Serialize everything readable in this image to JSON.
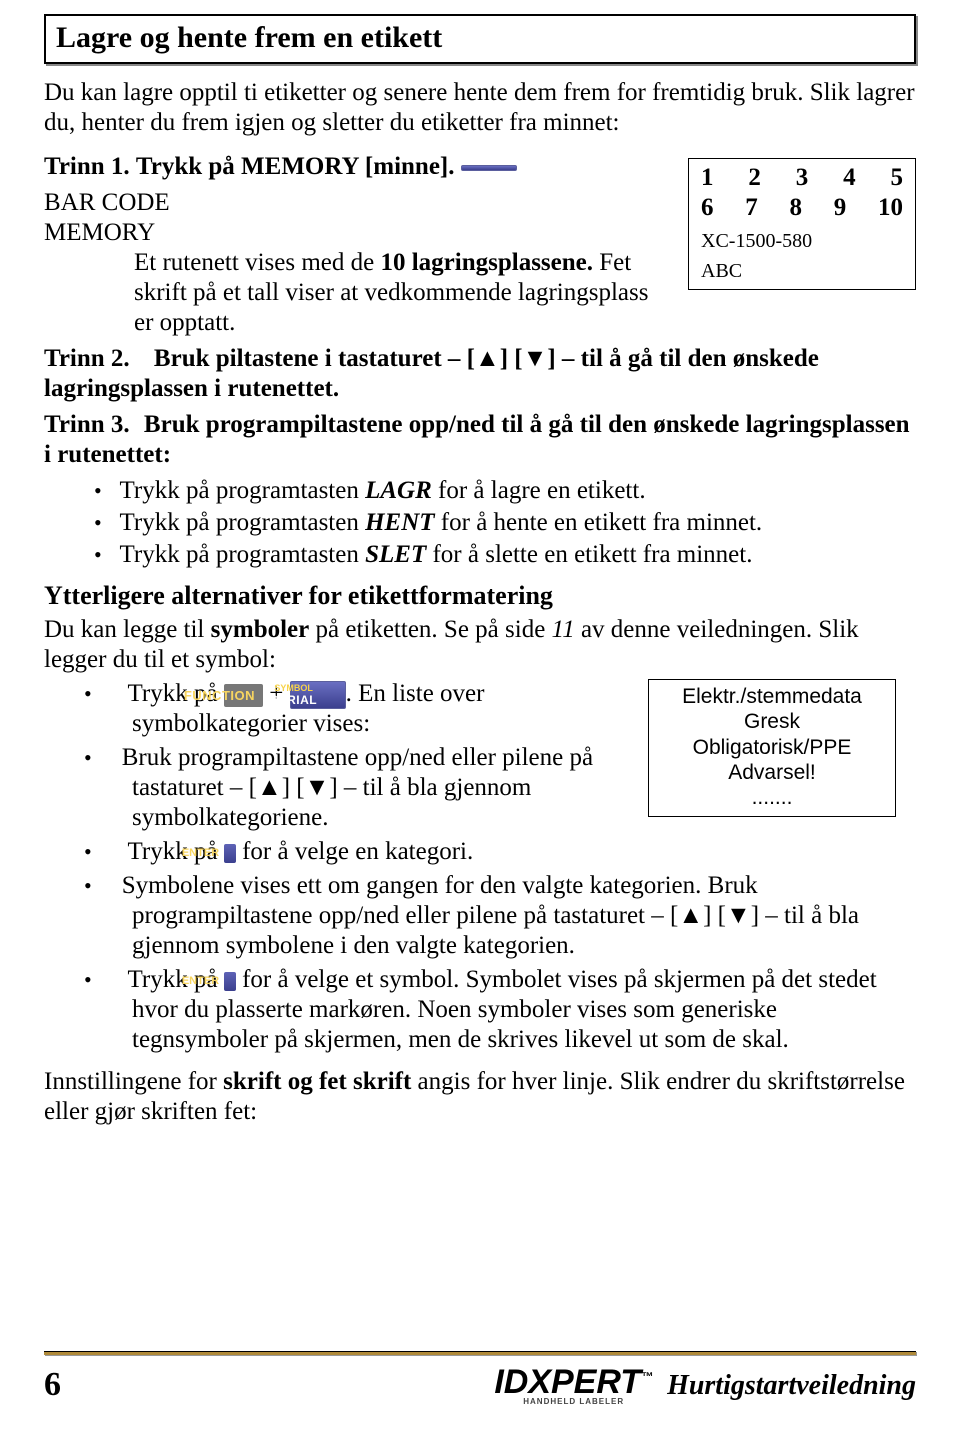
{
  "title": "Lagre og hente frem en etikett",
  "intro": "Du kan lagre opptil ti etiketter og senere hente dem frem for fremtidig bruk. Slik lagrer du, henter du frem igjen og sletter du etiketter fra minnet:",
  "memory_icon": {
    "line1": "BAR CODE",
    "line2": "MEMORY"
  },
  "grid_box": {
    "row1": [
      "1",
      "2",
      "3",
      "4",
      "5"
    ],
    "row2": [
      "6",
      "7",
      "8",
      "9",
      "10"
    ],
    "meta1": "XC-1500-580",
    "meta2": "ABC"
  },
  "step1": {
    "label": "Trinn 1.",
    "lead": "Trykk på MEMORY [minne].",
    "sub1": "Et rutenett vises med de ",
    "sub_bold10": "10 lagringsplassene.",
    "sub2": " Fet skrift på et tall viser at vedkommende lagringsplass er opptatt."
  },
  "step2": {
    "label": "Trinn 2.",
    "text_a": "Bruk piltastene i tastaturet – [▲] [▼] – til å gå til den ønskede lagringsplassen i rutenettet."
  },
  "step3": {
    "label": "Trinn 3.",
    "text": "Bruk programpiltastene opp/ned til å gå til den ønskede lagringsplassen i rutenettet:"
  },
  "bullets_a": [
    {
      "pre": "Trykk på programtasten ",
      "em": "LAGR",
      "post": " for å lagre en etikett."
    },
    {
      "pre": "Trykk på programtasten ",
      "em": "HENT",
      "post": " for å hente en etikett fra minnet."
    },
    {
      "pre": "Trykk på programtasten ",
      "em": "SLET",
      "post": " for å slette en etikett fra minnet."
    }
  ],
  "subhead": "Ytterligere alternativer for etikettformatering",
  "sym_intro1": "Du kan legge til ",
  "sym_intro_bold": "symboler",
  "sym_intro2": " på etiketten. Se på side ",
  "sym_intro_page": "11",
  "sym_intro3": " av denne veiledningen. Slik legger du til et symbol:",
  "func_icon": "FUNCTION",
  "serial_icon": {
    "line1": "SYMBOL",
    "line2": "SERIAL"
  },
  "enter_icon": "ENTER",
  "sym_box": {
    "l1": "Elektr./stemmedata",
    "l2": "Gresk",
    "l3": "Obligatorisk/PPE",
    "l4": "Advarsel!",
    "l5": "......."
  },
  "bullets_b": {
    "b1_pre": "Trykk på ",
    "b1_mid": " + ",
    "b1_post": ". En liste over symbolkategorier vises:",
    "b2": "Bruk programpiltastene opp/ned eller pilene på tastaturet – [▲] [▼] – til å bla gjennom symbolkategoriene.",
    "b3_pre": "Trykk på ",
    "b3_post": " for å velge en kategori.",
    "b4": "Symbolene vises ett om gangen for den valgte kategorien. Bruk programpiltastene opp/ned eller pilene på tastaturet – [▲] [▼] – til å bla gjennom symbolene i den valgte kategorien.",
    "b5_pre": "Trykk på ",
    "b5_post": " for å velge et symbol. Symbolet vises på skjermen på det stedet hvor du plasserte markøren. Noen symboler vises som generiske tegnsymboler på skjermen, men de skrives likevel ut som de skal."
  },
  "closing1": "Innstillingene for ",
  "closing_bold": "skrift og fet skrift",
  "closing2": " angis for hver linje. Slik endrer du skriftstørrelse eller gjør skriften fet:",
  "footer": {
    "page": "6",
    "brand": "IDXPERT",
    "tag": "HANDHELD LABELER",
    "tm": "™",
    "guide": "Hurtigstartveiledning"
  }
}
